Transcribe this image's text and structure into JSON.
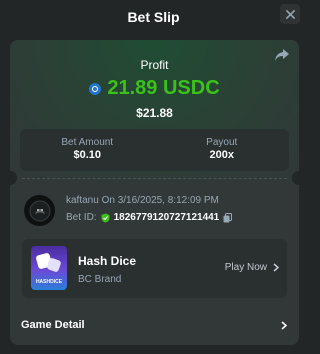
{
  "header": {
    "title": "Bet Slip"
  },
  "profit": {
    "label": "Profit",
    "currency_icon": "usdc-coin-icon",
    "amount": "21.89 USDC",
    "fiat": "$21.88",
    "accent_color": "#3bc117"
  },
  "stats": {
    "bet_amount_label": "Bet Amount",
    "bet_amount_value": "$0.10",
    "payout_label": "Payout",
    "payout_value": "200x"
  },
  "bet_info": {
    "user_line": "kaftanu On 3/16/2025, 8:12:09 PM",
    "bet_id_label": "Bet ID:",
    "bet_id_value": "1826779120727121441"
  },
  "game": {
    "thumbnail_text": "HASHDICE",
    "title": "Hash Dice",
    "brand": "BC Brand",
    "play_label": "Play Now"
  },
  "footer": {
    "game_detail_label": "Game Detail"
  }
}
